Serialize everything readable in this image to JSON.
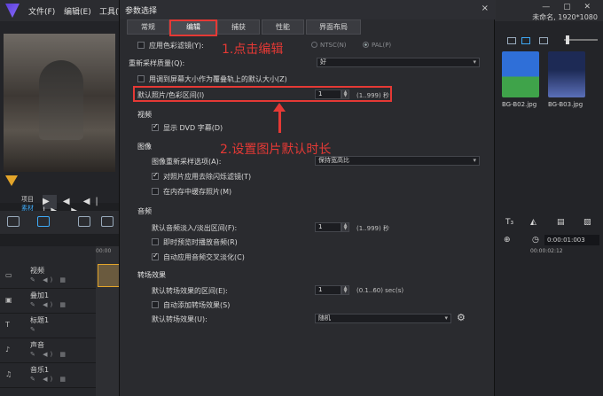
{
  "app": {
    "menu": [
      "文件(F)",
      "编辑(E)",
      "工具(T)"
    ],
    "project_info": "未命名, 1920*1080"
  },
  "player": {
    "project_label": "项目",
    "clip_label": "素材"
  },
  "library": {
    "thumbs": [
      {
        "label": "BG-B02.jpg",
        "color_top": "#2f6fd8",
        "color_bottom": "#3fa34a"
      },
      {
        "label": "BG-B03.jpg",
        "color_top": "#1d2a55",
        "color_bottom": "#5a6fb8"
      }
    ],
    "timecode": "0:00:01:003",
    "ruler_time": "00:00:02:12"
  },
  "timeline": {
    "ruler": "00:00",
    "tracks": [
      {
        "name": "视频",
        "icon": "video-track-icon"
      },
      {
        "name": "叠加1",
        "icon": "overlay-track-icon"
      },
      {
        "name": "标题1",
        "icon": "title-track-icon"
      },
      {
        "name": "声音",
        "icon": "voice-track-icon"
      },
      {
        "name": "音乐1",
        "icon": "music-track-icon"
      }
    ]
  },
  "dialog": {
    "title": "参数选择",
    "close": "×",
    "tabs": [
      {
        "label": "常规",
        "active": false
      },
      {
        "label": "编辑",
        "active": true
      },
      {
        "label": "捕获",
        "active": false
      },
      {
        "label": "性能",
        "active": false
      },
      {
        "label": "界面布局",
        "active": false
      }
    ],
    "apply_color_filter": {
      "label": "应用色彩滤镜(Y):",
      "checked": false
    },
    "tv_standard": {
      "ntsc": "NTSC(N)",
      "pal": "PAL(P)",
      "selected": "PAL(P)"
    },
    "resample_quality": {
      "label": "重新采样质量(Q):",
      "value": "好"
    },
    "fit_to_screen": {
      "label": "用调到屏幕大小作为覆叠轨上的默认大小(Z)",
      "checked": false
    },
    "default_photo_duration": {
      "label": "默认照片/色彩区间(I)",
      "value": "1",
      "range": "(1..999) 秒"
    },
    "video_section": "视频",
    "show_dvd_subtitles": {
      "label": "显示 DVD 字幕(D)",
      "checked": true
    },
    "image_section": "图像",
    "image_resample": {
      "label": "图像重新采样选项(A):",
      "value": "保持宽高比"
    },
    "apply_deflicker": {
      "label": "对照片应用去除闪烁滤镜(T)",
      "checked": true
    },
    "cache_photos": {
      "label": "在内存中缓存照片(M)",
      "checked": false
    },
    "audio_section": "音频",
    "audio_fade": {
      "label": "默认音频淡入/淡出区间(F):",
      "value": "1",
      "range": "(1..999) 秒"
    },
    "instant_preview": {
      "label": "即时预览时播放音频(R)",
      "checked": false
    },
    "auto_crossfade": {
      "label": "自动应用音频交叉淡化(C)",
      "checked": true
    },
    "transition_section": "转场效果",
    "transition_duration": {
      "label": "默认转场效果的区间(E):",
      "value": "1",
      "range": "(0.1..60) sec(s)"
    },
    "auto_add_transition": {
      "label": "自动添加转场效果(S)",
      "checked": false
    },
    "default_transition": {
      "label": "默认转场效果(U):",
      "value": "随机"
    }
  },
  "annotations": {
    "step1": "1.点击编辑",
    "step2": "2.设置图片默认时长",
    "color": "#e53935"
  }
}
